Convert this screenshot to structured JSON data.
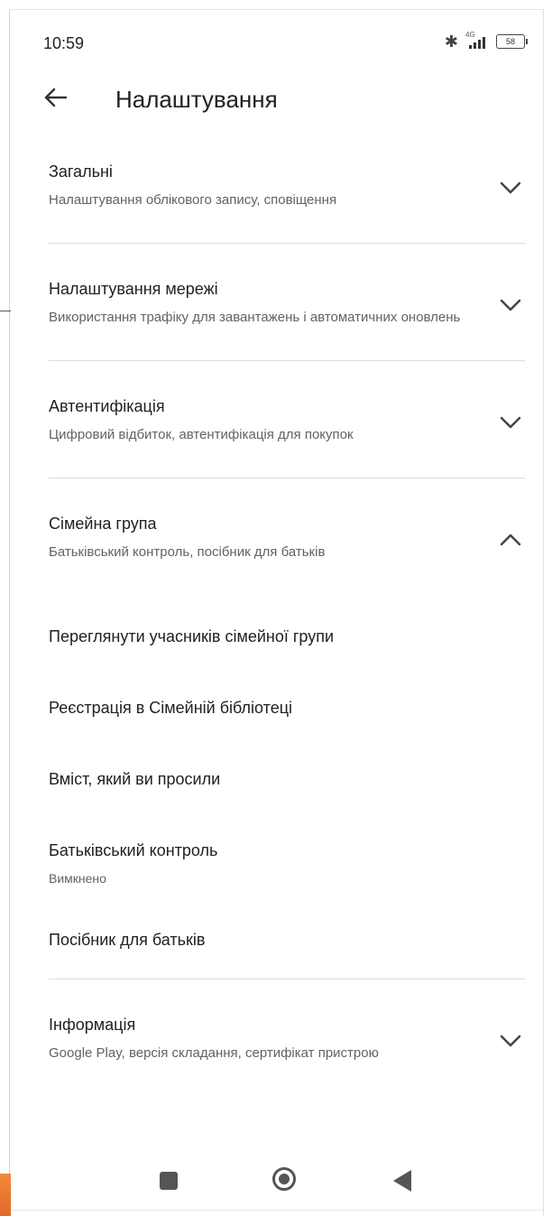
{
  "status_bar": {
    "time": "10:59",
    "network_label": "4G",
    "battery_level": "58",
    "icons": [
      "bluetooth-icon",
      "signal-icon",
      "battery-icon"
    ]
  },
  "header": {
    "back_icon": "arrow-left-icon",
    "title": "Налаштування"
  },
  "sections": [
    {
      "title": "Загальні",
      "subtitle": "Налаштування облікового запису, сповіщення",
      "expanded": false
    },
    {
      "title": "Налаштування мережі",
      "subtitle": "Використання трафіку для завантажень і автоматичних оновлень",
      "expanded": false
    },
    {
      "title": "Автентифікація",
      "subtitle": "Цифровий відбиток, автентифікація для покупок",
      "expanded": false
    },
    {
      "title": "Сімейна група",
      "subtitle": "Батьківський контроль, посібник для батьків",
      "expanded": true,
      "items": [
        {
          "title": "Переглянути учасників сімейної групи"
        },
        {
          "title": "Реєстрація в Сімейній бібліотеці"
        },
        {
          "title": "Вміст, який ви просили"
        },
        {
          "title": "Батьківський контроль",
          "desc": "Вимкнено"
        },
        {
          "title": "Посібник для батьків"
        }
      ]
    },
    {
      "title": "Інформація",
      "subtitle": "Google Play, версія складання, сертифікат пристрою",
      "expanded": false
    }
  ],
  "nav_bar": {
    "icons": [
      "recents-square-icon",
      "home-circle-icon",
      "back-triangle-icon"
    ]
  },
  "colors": {
    "text_primary": "#202124",
    "text_secondary": "#5f6368",
    "divider": "#dadce0",
    "icon": "#555555"
  }
}
